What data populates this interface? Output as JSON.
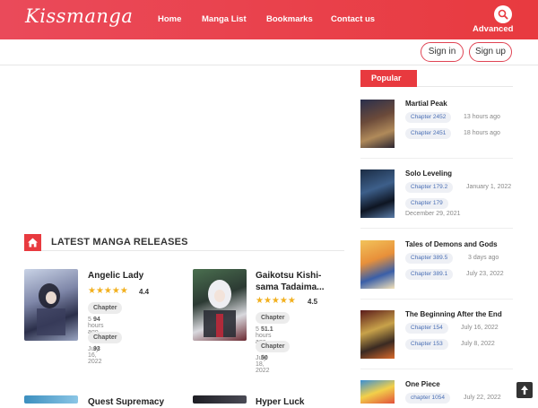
{
  "header": {
    "logo": "Kissmanga",
    "nav": [
      "Home",
      "Manga List",
      "Bookmarks",
      "Contact us"
    ],
    "search_icon": "search-icon",
    "advanced": "Advanced",
    "sign_in": "Sign in",
    "sign_up": "Sign up",
    "accent_color": "#e83a3f"
  },
  "latest": {
    "heading": "LATEST MANGA RELEASES",
    "items": [
      {
        "title": "Angelic Lady",
        "rating": "4.4",
        "chapters": [
          {
            "label": "Chapter 94",
            "time": "5 hours ago"
          },
          {
            "label": "Chapter 93",
            "time": "July 16, 2022"
          }
        ]
      },
      {
        "title": "Gaikotsu Kishi-sama Tadaima...",
        "rating": "4.5",
        "chapters": [
          {
            "label": "Chapter 51.1",
            "time": "5 hours ago"
          },
          {
            "label": "Chapter 50",
            "time": "July 18, 2022"
          }
        ]
      },
      {
        "title": "Quest Supremacy",
        "rating": "",
        "chapters": []
      },
      {
        "title": "Hyper Luck",
        "rating": "",
        "chapters": []
      }
    ]
  },
  "popular": {
    "heading": "Popular",
    "items": [
      {
        "title": "Martial Peak",
        "chapters": [
          {
            "label": "Chapter 2452",
            "time": "13 hours ago"
          },
          {
            "label": "Chapter 2451",
            "time": "18 hours ago"
          }
        ]
      },
      {
        "title": "Solo Leveling",
        "chapters": [
          {
            "label": "Chapter 179.2",
            "time": "January 1, 2022"
          },
          {
            "label": "Chapter 179",
            "time": "December 29, 2021"
          }
        ]
      },
      {
        "title": "Tales of Demons and Gods",
        "chapters": [
          {
            "label": "Chapter 389.5",
            "time": "3 days ago"
          },
          {
            "label": "Chapter 389.1",
            "time": "July 23, 2022"
          }
        ]
      },
      {
        "title": "The Beginning After the End",
        "chapters": [
          {
            "label": "Chapter 154",
            "time": "July 16, 2022"
          },
          {
            "label": "Chapter 153",
            "time": "July 8, 2022"
          }
        ]
      },
      {
        "title": "One Piece",
        "chapters": [
          {
            "label": "chapter 1054",
            "time": "July 22, 2022"
          }
        ]
      }
    ]
  }
}
